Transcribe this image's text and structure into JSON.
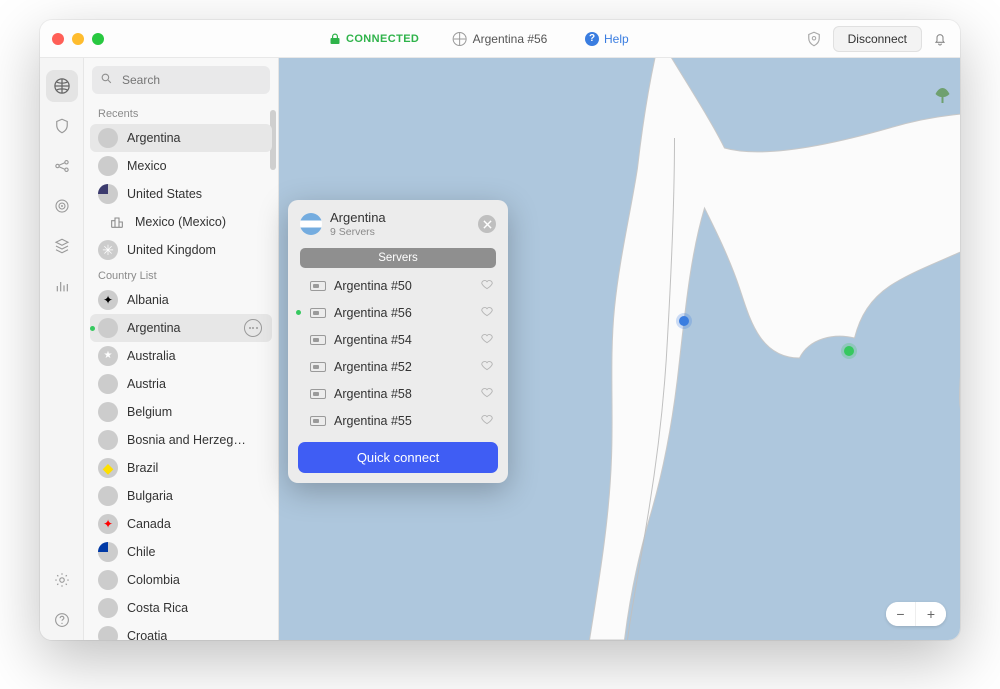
{
  "titlebar": {
    "status_label": "CONNECTED",
    "server_label": "Argentina #56",
    "help_label": "Help",
    "disconnect_label": "Disconnect"
  },
  "sidebar": {
    "search_placeholder": "Search",
    "sections": {
      "recents_label": "Recents",
      "countries_label": "Country List"
    },
    "recents": [
      {
        "name": "Argentina",
        "flag": "flag-ar",
        "active": true
      },
      {
        "name": "Mexico",
        "flag": "flag-mx"
      },
      {
        "name": "United States",
        "flag": "flag-us"
      },
      {
        "name": "Mexico (Mexico)",
        "city": true
      },
      {
        "name": "United Kingdom",
        "flag": "flag-uk"
      }
    ],
    "countries": [
      {
        "name": "Albania",
        "flag": "flag-al"
      },
      {
        "name": "Argentina",
        "flag": "flag-ar",
        "active": true,
        "green_dot": true,
        "more": true
      },
      {
        "name": "Australia",
        "flag": "flag-au"
      },
      {
        "name": "Austria",
        "flag": "flag-at"
      },
      {
        "name": "Belgium",
        "flag": "flag-be"
      },
      {
        "name": "Bosnia and Herzeg…",
        "flag": "flag-ba"
      },
      {
        "name": "Brazil",
        "flag": "flag-br"
      },
      {
        "name": "Bulgaria",
        "flag": "flag-bg"
      },
      {
        "name": "Canada",
        "flag": "flag-ca"
      },
      {
        "name": "Chile",
        "flag": "flag-cl"
      },
      {
        "name": "Colombia",
        "flag": "flag-co"
      },
      {
        "name": "Costa Rica",
        "flag": "flag-cr"
      },
      {
        "name": "Croatia",
        "flag": "flag-hr"
      }
    ]
  },
  "popover": {
    "country": "Argentina",
    "servers_count_label": "9 Servers",
    "tab_label": "Servers",
    "servers": [
      {
        "name": "Argentina #50"
      },
      {
        "name": "Argentina #56",
        "active": true
      },
      {
        "name": "Argentina #54"
      },
      {
        "name": "Argentina #52"
      },
      {
        "name": "Argentina #58"
      },
      {
        "name": "Argentina #55"
      }
    ],
    "quick_connect_label": "Quick connect"
  },
  "zoom": {
    "minus": "−",
    "plus": "+"
  }
}
